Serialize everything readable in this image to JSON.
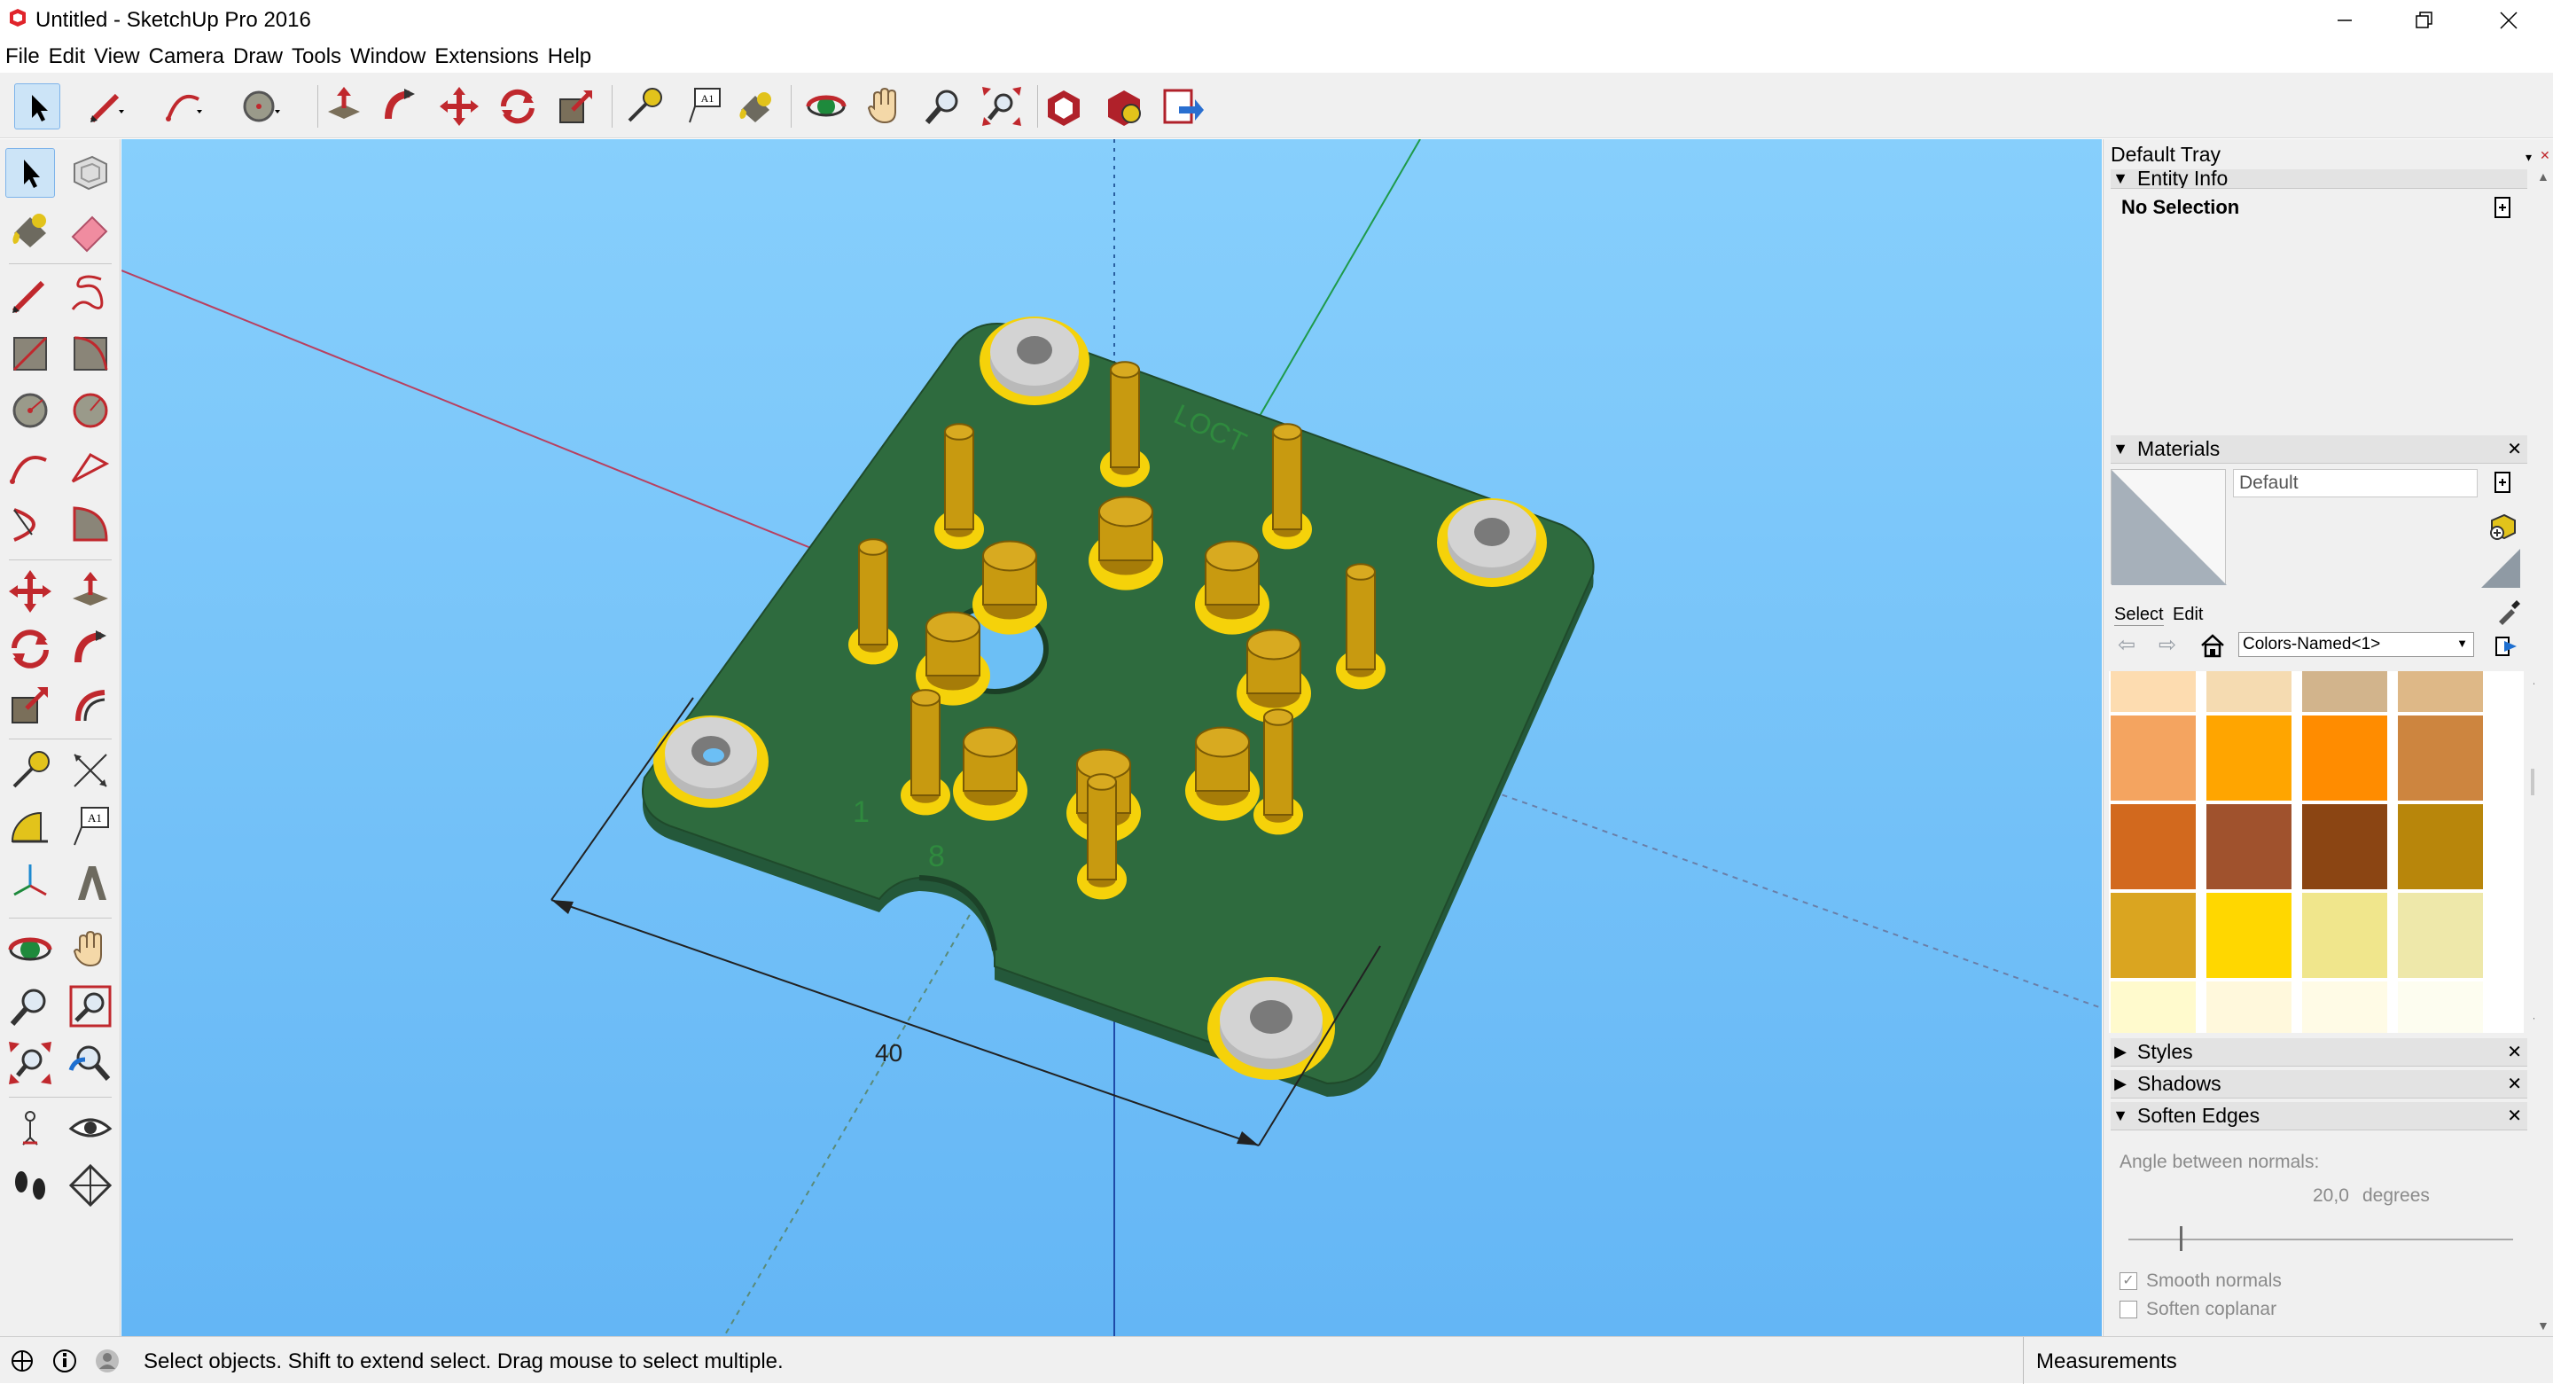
{
  "window": {
    "title": "Untitled - SketchUp Pro 2016",
    "controls": {
      "minimize": "minimize-icon",
      "restore": "restore-icon",
      "close": "close-icon"
    }
  },
  "menu": [
    "File",
    "Edit",
    "View",
    "Camera",
    "Draw",
    "Tools",
    "Window",
    "Extensions",
    "Help"
  ],
  "toolbar": {
    "tools": [
      "select",
      "pencil",
      "arc",
      "circle",
      "push-pull",
      "follow-me",
      "move",
      "rotate",
      "scale",
      "tape-measure",
      "text",
      "paint-bucket",
      "orbit",
      "pan",
      "zoom",
      "zoom-extents",
      "warehouse",
      "extension-warehouse",
      "send-to-layout"
    ]
  },
  "viewport": {
    "dimension_label": "40",
    "model_text": {
      "brand": "LOCT",
      "pin1": "1",
      "pin8": "8"
    },
    "colors": {
      "sky": "#87cffc",
      "board": "#2e6b3e",
      "pad": "#f5d20a",
      "pin": "#c89a10",
      "washer": "#c8c8c8"
    }
  },
  "tray": {
    "title": "Default Tray",
    "entity_info": {
      "title": "Entity Info",
      "selection": "No Selection"
    },
    "materials": {
      "title": "Materials",
      "current": "Default",
      "tabs": [
        "Select",
        "Edit"
      ],
      "collection": "Colors-Named<1>",
      "swatches": [
        [
          "#fddcb0",
          "#f5dbb1",
          "#d2b48c",
          "#deb887"
        ],
        [
          "#f4a460",
          "#ffa500",
          "#ff8c00",
          "#cd853f"
        ],
        [
          "#d2691e",
          "#a0522d",
          "#8b4513",
          "#b8860b"
        ],
        [
          "#daa520",
          "#ffd700",
          "#f0e68c",
          "#eee8aa"
        ],
        [
          "#fffacd",
          "#fff8dc",
          "#fffbe6",
          "#fdfdf0"
        ]
      ]
    },
    "panels": {
      "styles": "Styles",
      "shadows": "Shadows",
      "soften_edges": "Soften Edges"
    },
    "soften": {
      "angle_label": "Angle between normals:",
      "angle_value": "20,0",
      "angle_unit": "degrees",
      "smooth_normals": "Smooth normals",
      "soften_coplanar": "Soften coplanar"
    }
  },
  "statusbar": {
    "message": "Select objects. Shift to extend select. Drag mouse to select multiple.",
    "measurements": "Measurements"
  }
}
